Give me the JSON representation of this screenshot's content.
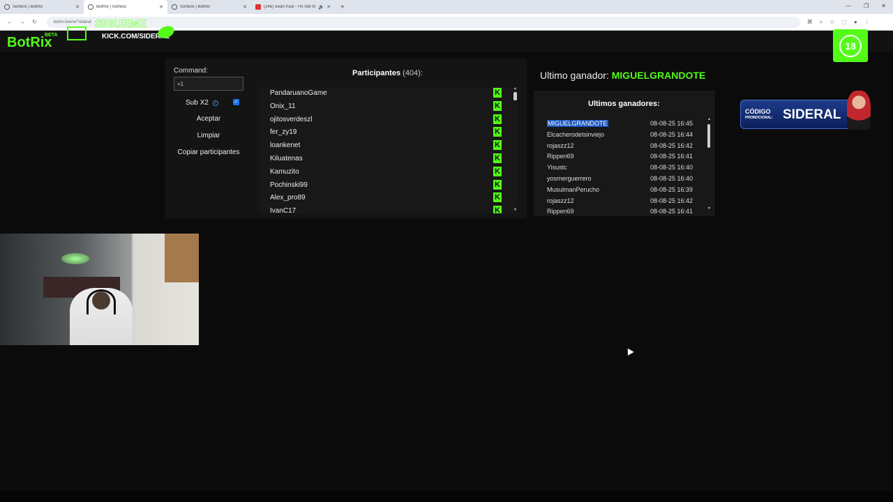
{
  "browser": {
    "tabs": [
      {
        "label": "Sorteos | BotRix",
        "active": false,
        "icon": "globe-icon"
      },
      {
        "label": "BotRix | Sorteos",
        "active": true,
        "icon": "globe-icon"
      },
      {
        "label": "Sorteos | BotRix",
        "active": false,
        "icon": "globe-icon"
      },
      {
        "label": "(246) Sean Paul - I'm Still In",
        "active": false,
        "icon": "youtube-icon"
      }
    ],
    "url": "botrix.live/w/?sideral"
  },
  "header": {
    "logo": "BotRix",
    "beta": "BETA",
    "overlay_follow": "SIGUEME",
    "overlay_kick": "KICK.COM/SIDERAL",
    "age_badge": "18"
  },
  "controls": {
    "command_label": "Command:",
    "command_value": "+1",
    "sub_label": "Sub X2",
    "sub_checked": true,
    "accept": "Aceptar",
    "clear": "Limpiar",
    "copy": "Copiar participantes"
  },
  "participants": {
    "title": "Participantes",
    "count": "(404):",
    "items": [
      "PandaruanoGame",
      "Onix_11",
      "ojitosverdeszl",
      "fer_zy19",
      "loankenet",
      "Kiluatenas",
      "Kamuzito",
      "Pochinski99",
      "Alex_pro89",
      "IvanC17"
    ],
    "platform_icon": "K"
  },
  "winner": {
    "label": "Ultimo ganador:",
    "name": "MIGUELGRANDOTE"
  },
  "winners": {
    "title": "Ultimos ganadores:",
    "items": [
      {
        "name": "MIGUELGRANDOTE",
        "time": "08-08-25 16:45"
      },
      {
        "name": "Elcacherodelsinviejo",
        "time": "08-08-25 16:44"
      },
      {
        "name": "rojaszz12",
        "time": "08-08-25 16:42"
      },
      {
        "name": "Rippen69",
        "time": "08-08-25 16:41"
      },
      {
        "name": "Yisustc",
        "time": "08-08-25 16:40"
      },
      {
        "name": "yosmerguerrero",
        "time": "08-08-25 16:40"
      },
      {
        "name": "MusulmanPerucho",
        "time": "08-08-25 16:39"
      },
      {
        "name": "rojaszz12",
        "time": "08-08-25 16:42"
      },
      {
        "name": "Rippen69",
        "time": "08-08-25 16:41"
      }
    ]
  },
  "promo": {
    "code": "CÓDIGO",
    "promo_label": "PROMOCIONAL:",
    "name": "SIDERAL"
  },
  "colors": {
    "accent": "#53fc18",
    "selection": "#1b57c2"
  }
}
